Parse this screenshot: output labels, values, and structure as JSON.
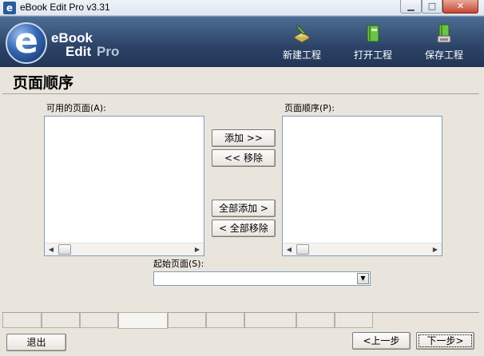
{
  "window": {
    "app_icon_glyph": "e",
    "title": "eBook Edit Pro v3.31",
    "min_glyph": "▁",
    "max_glyph": "□",
    "close_glyph": "✕"
  },
  "banner": {
    "logo_letter": "e",
    "logo_word1": "eBook",
    "logo_word2": "Edit",
    "logo_word3": "Pro",
    "tools": [
      {
        "label": "新建工程",
        "icon": "new-project-icon"
      },
      {
        "label": "打开工程",
        "icon": "open-project-icon"
      },
      {
        "label": "保存工程",
        "icon": "save-project-icon"
      }
    ]
  },
  "page": {
    "title": "页面顺序",
    "available_label": "可用的页面(A):",
    "order_label": "页面顺序(P):",
    "available_items": [],
    "order_items": [],
    "add_button": "添加 >>",
    "remove_button": "<< 移除",
    "add_all_button": "全部添加 >",
    "remove_all_button": "< 全部移除",
    "start_page_label": "起始页面(S):",
    "start_page_value": "",
    "scroll_left_glyph": "◀",
    "scroll_right_glyph": "▶",
    "combo_arrow_glyph": "▼"
  },
  "footer": {
    "exit_button": "退出",
    "prev_button": "<上一步",
    "next_button": "下一步>"
  },
  "colors": {
    "banner": "#2c4366",
    "background": "#e9e5dc",
    "list_border": "#7f9db9"
  }
}
